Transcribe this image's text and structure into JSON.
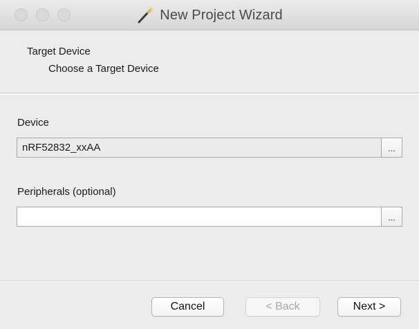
{
  "window": {
    "title": "New Project Wizard",
    "title_icon": "magic-wand-icon"
  },
  "header": {
    "title": "Target Device",
    "subtitle": "Choose a Target Device"
  },
  "device": {
    "label": "Device",
    "value": "nRF52832_xxAA",
    "browse_label": "..."
  },
  "peripherals": {
    "label": "Peripherals (optional)",
    "value": "",
    "browse_label": "..."
  },
  "footer": {
    "cancel_label": "Cancel",
    "back_label": "< Back",
    "next_label": "Next >"
  },
  "colors": {
    "window_bg": "#ececec",
    "disabled_text": "#a8a8a8"
  }
}
